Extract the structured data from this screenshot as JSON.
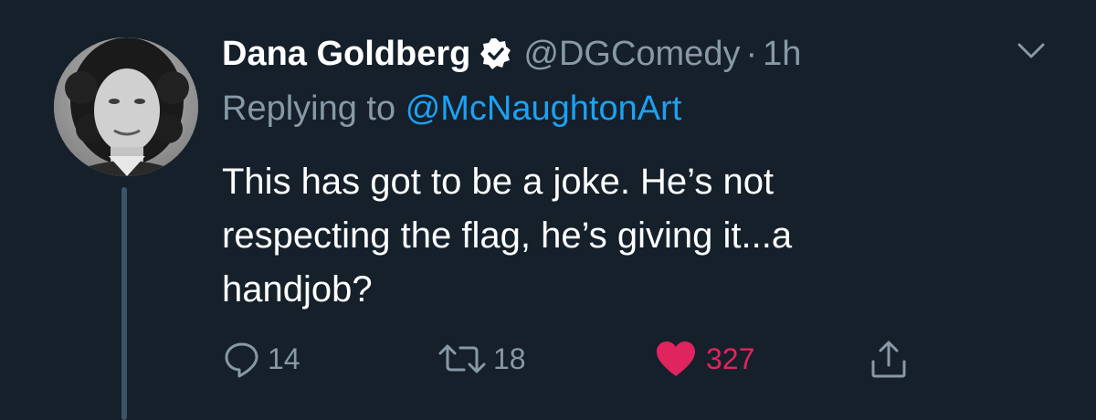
{
  "tweet": {
    "display_name": "Dana Goldberg",
    "handle": "@DGComedy",
    "separator": "·",
    "time": "1h",
    "replying_prefix": "Replying to",
    "replying_to": "@McNaughtonArt",
    "text_lines": [
      "This has got to be a joke. He’s not",
      "respecting the flag, he’s giving it...a",
      "handjob?"
    ],
    "verified": true,
    "avatar_icon": "profile-photo"
  },
  "actions": {
    "reply": {
      "icon": "reply-bubble-icon",
      "count": "14"
    },
    "retweet": {
      "icon": "retweet-icon",
      "count": "18"
    },
    "like": {
      "icon": "heart-icon",
      "count": "327",
      "liked": true
    },
    "share": {
      "icon": "share-icon",
      "count": ""
    }
  },
  "colors": {
    "background": "#15202b",
    "text": "#ffffff",
    "secondary": "#8899a6",
    "link": "#1da1f2",
    "like": "#e0245e",
    "thread_line": "#3d5466"
  }
}
